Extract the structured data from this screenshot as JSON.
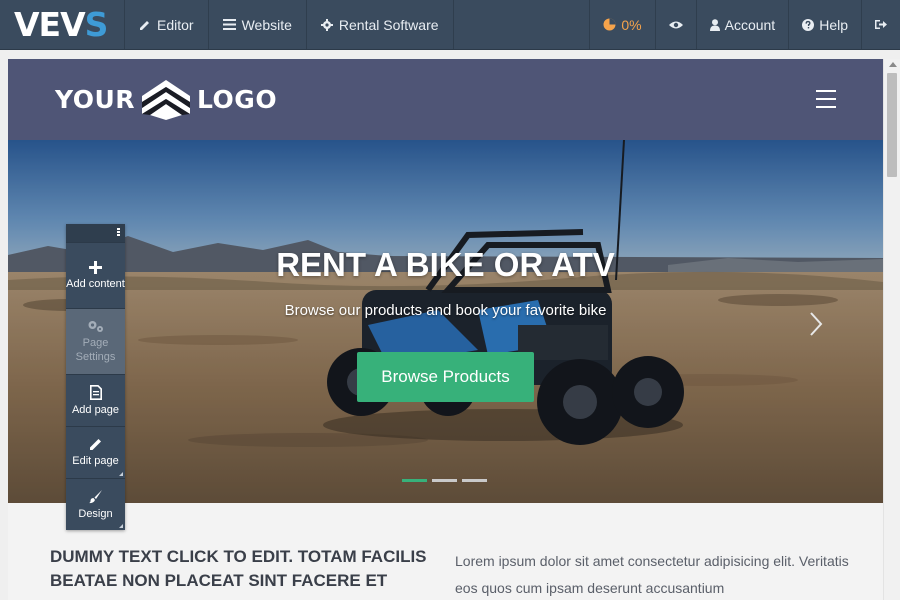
{
  "topbar": {
    "brand": {
      "main": "VEV",
      "last": "S"
    },
    "nav": [
      {
        "label": "Editor",
        "icon": "pencil-icon"
      },
      {
        "label": "Website",
        "icon": "list-icon"
      },
      {
        "label": "Rental Software",
        "icon": "gear-icon"
      }
    ],
    "progress": "0%",
    "preview_icon": "eye-icon",
    "account": "Account",
    "help": "Help",
    "logout_icon": "sign-out-icon"
  },
  "site": {
    "logo_left": "YOUR",
    "logo_right": "LOGO",
    "menu_icon": "hamburger-icon"
  },
  "hero": {
    "title": "RENT A BIKE OR ATV",
    "subtitle": "Browse our products and book your favorite bike",
    "button": "Browse Products",
    "slides": 3,
    "active_slide": 1
  },
  "content": {
    "heading": "DUMMY TEXT CLICK TO EDIT. TOTAM FACILIS BEATAE NON PLACEAT SINT FACERE ET",
    "body": "Lorem ipsum dolor sit amet consectetur adipisicing elit. Veritatis eos quos cum ipsam deserunt accusantium"
  },
  "palette": {
    "tools": [
      {
        "label": "Add content",
        "icon": "plus-icon",
        "enabled": true
      },
      {
        "label": "Page Settings",
        "icon": "gears-icon",
        "enabled": false
      },
      {
        "label": "Add page",
        "icon": "file-icon",
        "enabled": true
      },
      {
        "label": "Edit page",
        "icon": "pencil-icon",
        "enabled": true
      },
      {
        "label": "Design",
        "icon": "brush-icon",
        "enabled": true
      }
    ]
  },
  "colors": {
    "topbar": "#3a4b5e",
    "brand_accent": "#3e9bd6",
    "site_header": "#4f5576",
    "hero_button": "#37b17a",
    "progress": "#f5a34b"
  }
}
